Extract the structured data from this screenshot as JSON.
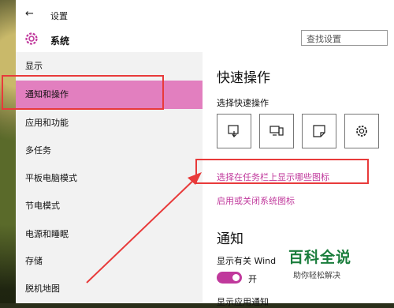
{
  "window": {
    "title": "设置",
    "back_glyph": "←"
  },
  "header": {
    "app_title": "系统",
    "search_placeholder": "查找设置"
  },
  "sidebar": {
    "items": [
      {
        "label": "显示",
        "active": false
      },
      {
        "label": "通知和操作",
        "active": true
      },
      {
        "label": "应用和功能",
        "active": false
      },
      {
        "label": "多任务",
        "active": false
      },
      {
        "label": "平板电脑模式",
        "active": false
      },
      {
        "label": "节电模式",
        "active": false
      },
      {
        "label": "电源和睡眠",
        "active": false
      },
      {
        "label": "存储",
        "active": false
      },
      {
        "label": "脱机地图",
        "active": false
      }
    ]
  },
  "main": {
    "quick_actions_heading": "快速操作",
    "quick_actions_sub": "选择快速操作",
    "quick_action_icons": [
      "tablet-mode-icon",
      "connect-icon",
      "note-icon",
      "settings-icon"
    ],
    "link_taskbar_icons": "选择在任务栏上显示哪些图标",
    "link_system_icons": "启用或关闭系统图标",
    "notifications_heading": "通知",
    "show_tips_label": "显示有关 Wind",
    "toggle_state": "开",
    "toggle_on": true,
    "show_app_notifications_label": "显示应用通知"
  },
  "watermark": {
    "title": "百科全说",
    "subtitle": "助你轻松解决"
  },
  "colors": {
    "accent": "#c0399c",
    "active_nav": "#e27fbf",
    "annotation_red": "#e83a3a",
    "watermark_green": "#1a7d3c"
  }
}
